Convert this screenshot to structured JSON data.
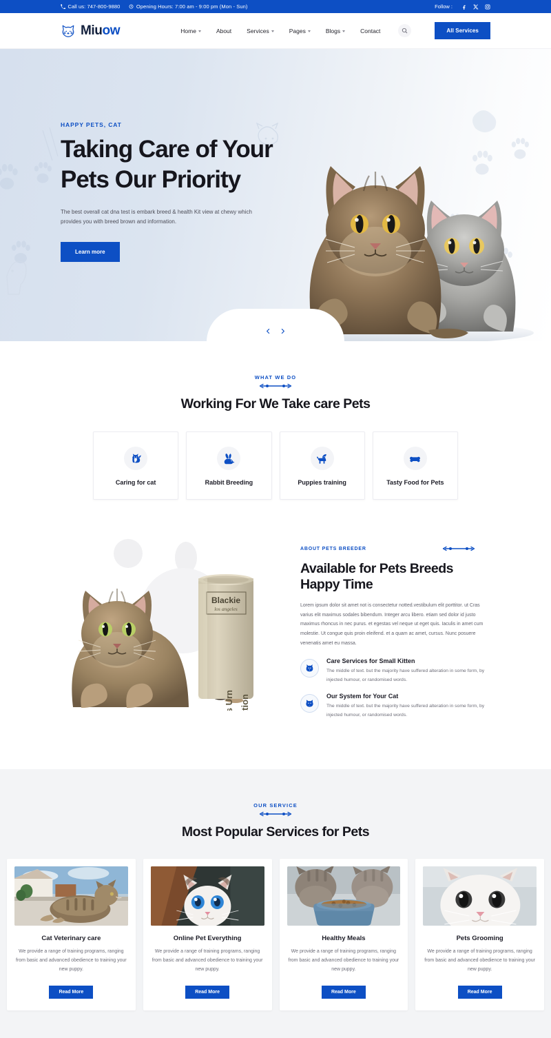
{
  "topbar": {
    "phone_icon": "phone-icon",
    "phone": "Call us: 747-800-9880",
    "hours_icon": "clock-icon",
    "hours": "Opening Hours: 7:00 am - 9:00 pm (Mon - Sun)",
    "follow_label": "Follow :",
    "socials": [
      {
        "name": "facebook-icon",
        "glyph": "f"
      },
      {
        "name": "x-twitter-icon",
        "glyph": "X"
      },
      {
        "name": "instagram-icon",
        "glyph": "IG"
      }
    ]
  },
  "header": {
    "logo_icon": "cat-head-logo-icon",
    "logo_first": "Miu",
    "logo_second": "ow",
    "nav": [
      {
        "label": "Home",
        "has_caret": true
      },
      {
        "label": "About",
        "has_caret": false
      },
      {
        "label": "Services",
        "has_caret": true
      },
      {
        "label": "Pages",
        "has_caret": true
      },
      {
        "label": "Blogs",
        "has_caret": true
      },
      {
        "label": "Contact",
        "has_caret": false
      }
    ],
    "search_icon": "search-icon",
    "cta_label": "All Services"
  },
  "hero": {
    "eyebrow": "HAPPY PETS, CAT",
    "title_line1": "Taking Care of Your",
    "title_line2": "Pets Our Priority",
    "subtitle": "The best overall cat dna test is embark breed & health Kit view at chewy which provides you with breed brown and information.",
    "button_label": "Learn more",
    "prev_icon": "chevron-left-icon",
    "next_icon": "chevron-right-icon",
    "photo_alt": "two-cats-photo"
  },
  "whatwedo": {
    "eyebrow": "WHAT WE DO",
    "title": "Working For We Take care Pets",
    "cards": [
      {
        "icon": "cat-icon",
        "label": "Caring for cat"
      },
      {
        "icon": "rabbit-icon",
        "label": "Rabbit Breeding"
      },
      {
        "icon": "dog-icon",
        "label": "Puppies training"
      },
      {
        "icon": "bone-icon",
        "label": "Tasty Food for Pets"
      }
    ]
  },
  "about": {
    "image_alt": "cat-with-pets-urn-photo",
    "urn_label_name": "Blackie",
    "urn_label_sub": "los angeles",
    "urn_text_a": "Pets Urn",
    "urn_text_b": "Bio-Cremation",
    "eyebrow": "ABOUT PETS BREEDER",
    "title": "Available for Pets Breeds Happy Time",
    "paragraph": "Lorem ipsum dolor sit amet not is consectetur notted.vestibulum elit porttitor. ut Cras varius elit maximus sodales bibendum. Integer arcu libero. etiam sed dolor id justo maximus rhoncus in nec purus. et egestas vel neque ut eget quis. Iaculis in amet cum molestie. Ut congue quis proin eleifend. et a quam ac amet, cursus. Nunc posuere venenatis amet eu massa.",
    "features": [
      {
        "icon": "cat-face-icon",
        "title": "Care Services for Small Kitten",
        "desc": "The middle of text. but the majority have suffered alteration in some form, by injected humour, or randomised words."
      },
      {
        "icon": "cat-face-round-icon",
        "title": "Our System for Your Cat",
        "desc": "The middle of text. but the majority have suffered alteration in some form, by injected humour, or randomised words."
      }
    ]
  },
  "services": {
    "eyebrow": "OUR SERVICE",
    "title": "Most Popular Services for Pets",
    "cards": [
      {
        "image": "tabby-cat-on-porch-photo",
        "title": "Cat Veterinary care",
        "desc": "We provide a range of training programs, ranging from basic and advanced obedience to training your new puppy.",
        "button": "Read More"
      },
      {
        "image": "white-kitten-blue-eyes-photo",
        "title": "Online Pet Everything",
        "desc": "We provide a range of training programs, ranging from basic and advanced obedience to training your new puppy.",
        "button": "Read More"
      },
      {
        "image": "two-cats-eating-from-bowl-photo",
        "title": "Healthy Meals",
        "desc": "We provide a range of training programs, ranging from basic and advanced obedience to training your new puppy.",
        "button": "Read More"
      },
      {
        "image": "white-cat-closeup-photo",
        "title": "Pets Grooming",
        "desc": "We provide a range of training programs, ranging from basic and advanced obedience to training your new puppy.",
        "button": "Read More"
      }
    ]
  },
  "colors": {
    "brand_blue": "#0d4fc4",
    "dark_navy": "#14213d",
    "hero_bg": "#dce4ef",
    "section_gray": "#f3f4f6",
    "text_dark": "#16161d",
    "text_muted": "#6d6d78"
  }
}
